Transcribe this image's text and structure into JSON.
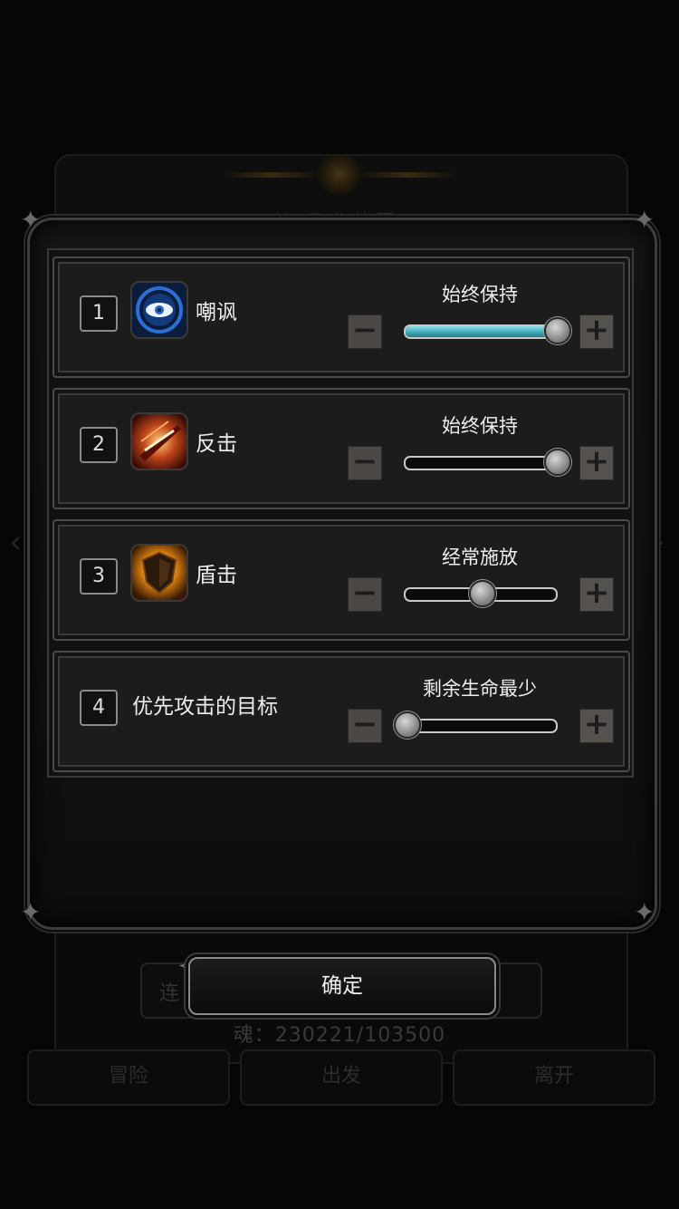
{
  "background": {
    "title": "部 圣龙将军",
    "left_arrow": "‹",
    "right_arrow": "›",
    "chain_label": "连",
    "souls": "魂：230221/103500",
    "tabs": [
      "冒险",
      "出发",
      "离开"
    ]
  },
  "tactics": [
    {
      "index": "1",
      "name": "嘲讽",
      "icon": "eye-icon",
      "mode": "始终保持",
      "level": 1.0,
      "highlighted": true
    },
    {
      "index": "2",
      "name": "反击",
      "icon": "slash-icon",
      "mode": "始终保持",
      "level": 1.0,
      "highlighted": false
    },
    {
      "index": "3",
      "name": "盾击",
      "icon": "shield-icon",
      "mode": "经常施放",
      "level": 0.5,
      "highlighted": false
    },
    {
      "index": "4",
      "name": "优先攻击的目标",
      "icon": "",
      "mode": "剩余生命最少",
      "level": 0.0,
      "highlighted": false
    }
  ],
  "step_buttons": {
    "minus": "−",
    "plus": "+"
  },
  "confirm_label": "确定",
  "colors": {
    "slider_fill": "#3aa6b4",
    "panel": "#1c1c1c",
    "border": "#4a4a4a"
  }
}
